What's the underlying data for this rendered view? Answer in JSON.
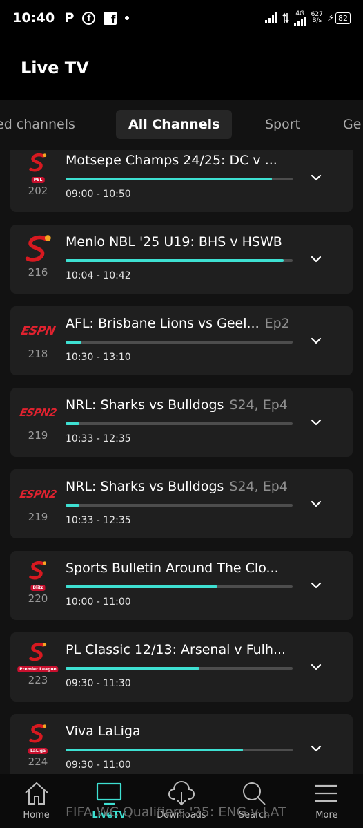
{
  "status_bar": {
    "time": "10:40",
    "icon_p": "P",
    "icon_circle_f": "f",
    "icon_square_f": "f",
    "net_type": "4G",
    "net_speed_value": "627",
    "net_speed_unit": "B/s",
    "battery": "82"
  },
  "header": {
    "title": "Live TV"
  },
  "tabs": [
    {
      "label": "ed channels",
      "active": false
    },
    {
      "label": "All Channels",
      "active": true
    },
    {
      "label": "Sport",
      "active": false
    },
    {
      "label": "Ge",
      "active": false
    }
  ],
  "channels": [
    {
      "logo": "supersport",
      "logo_tag": "PSL",
      "number": "202",
      "title": "Motsepe Champs 24/25: DC v ...",
      "episode": "",
      "progress": 0.91,
      "time": "09:00 - 10:50"
    },
    {
      "logo": "supersport-large",
      "logo_tag": "",
      "number": "216",
      "title": "Menlo NBL '25 U19: BHS v HSWB",
      "episode": "",
      "progress": 0.96,
      "time": "10:04 - 10:42"
    },
    {
      "logo": "espn",
      "logo_tag": "",
      "number": "218",
      "title": "AFL: Brisbane Lions vs Geel...",
      "episode": "Ep2",
      "progress": 0.07,
      "time": "10:30 - 13:10"
    },
    {
      "logo": "espn2",
      "logo_tag": "",
      "number": "219",
      "title": "NRL: Sharks vs Bulldogs",
      "episode": "S24, Ep4",
      "progress": 0.06,
      "time": "10:33 - 12:35"
    },
    {
      "logo": "espn2",
      "logo_tag": "",
      "number": "219",
      "title": "NRL: Sharks vs Bulldogs",
      "episode": "S24, Ep4",
      "progress": 0.06,
      "time": "10:33 - 12:35"
    },
    {
      "logo": "supersport",
      "logo_tag": "Blitz",
      "number": "220",
      "title": "Sports Bulletin Around The Clo...",
      "episode": "",
      "progress": 0.67,
      "time": "10:00 - 11:00"
    },
    {
      "logo": "supersport",
      "logo_tag": "Premier League",
      "number": "223",
      "title": "PL Classic 12/13: Arsenal v Fulh...",
      "episode": "",
      "progress": 0.59,
      "time": "09:30 - 11:30"
    },
    {
      "logo": "supersport",
      "logo_tag": "LaLiga",
      "number": "224",
      "title": "Viva LaLiga",
      "episode": "",
      "progress": 0.78,
      "time": "09:30 - 11:00"
    }
  ],
  "peek_title": "FIFA WC Qualifiers '25: ENG v LAT",
  "bottom_nav": [
    {
      "label": "Home",
      "icon": "home-icon",
      "active": false
    },
    {
      "label": "LiveTV",
      "icon": "tv-icon",
      "active": true
    },
    {
      "label": "Downloads",
      "icon": "cloud-download-icon",
      "active": false
    },
    {
      "label": "Search",
      "icon": "search-icon",
      "active": false
    },
    {
      "label": "More",
      "icon": "menu-icon",
      "active": false
    }
  ],
  "colors": {
    "accent": "#3ee0d2",
    "card": "#1f1f1f",
    "espn_red": "#e0222f",
    "supersport_red": "#d71920"
  }
}
